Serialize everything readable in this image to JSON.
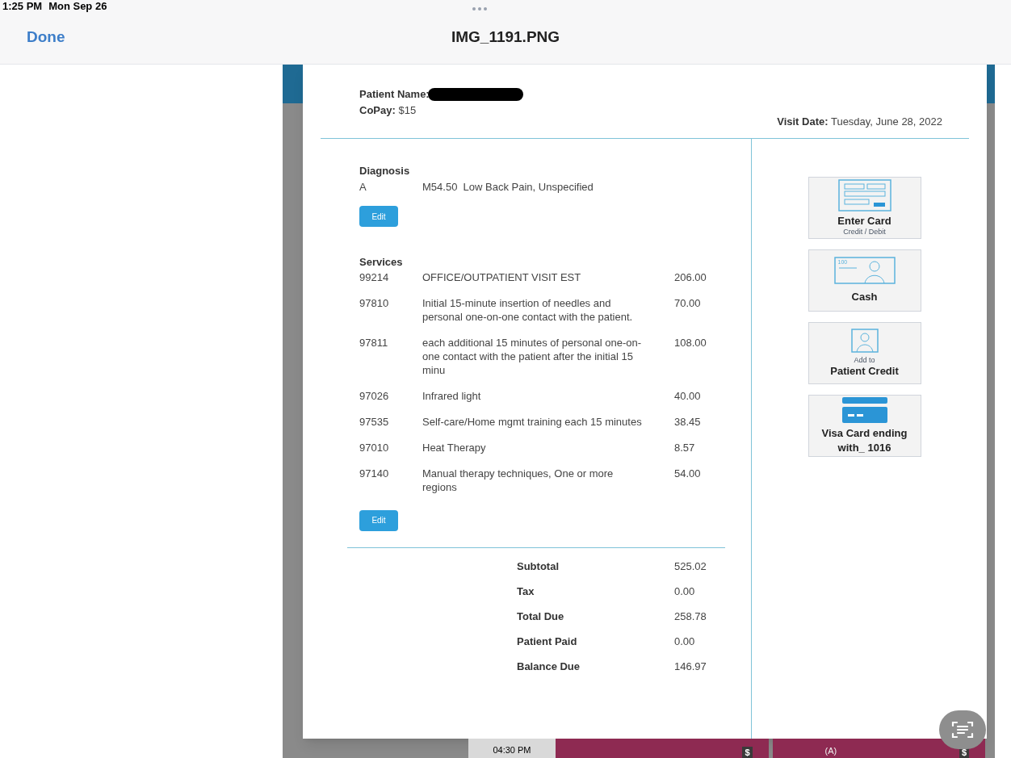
{
  "status_bar": {
    "time": "1:25 PM",
    "date": "Mon Sep 26"
  },
  "viewer": {
    "done": "Done",
    "title": "IMG_1191.PNG"
  },
  "invoice": {
    "patient_label": "Patient Name:",
    "copay_label": "CoPay:",
    "copay": "$15",
    "visit_date_label": "Visit Date:",
    "visit_date": "Tuesday, June 28, 2022",
    "diagnosis": {
      "heading": "Diagnosis",
      "items": [
        {
          "letter": "A",
          "text": "M54.50  Low Back Pain, Unspecified"
        }
      ],
      "edit": "Edit"
    },
    "services": {
      "heading": "Services",
      "items": [
        {
          "code": "99214",
          "description": "OFFICE/OUTPATIENT VISIT EST",
          "amount": "206.00"
        },
        {
          "code": "97810",
          "description": "Initial 15-minute insertion of needles and personal one-on-one contact with the patient.",
          "amount": "70.00"
        },
        {
          "code": "97811",
          "description": "each additional 15 minutes of personal one-on-one contact with the patient after the initial 15 minu",
          "amount": "108.00"
        },
        {
          "code": "97026",
          "description": "Infrared light",
          "amount": "40.00"
        },
        {
          "code": "97535",
          "description": "Self-care/Home mgmt training each 15 minutes",
          "amount": "38.45"
        },
        {
          "code": "97010",
          "description": "Heat Therapy",
          "amount": "8.57"
        },
        {
          "code": "97140",
          "description": "Manual therapy techniques, One or more regions",
          "amount": "54.00"
        }
      ],
      "edit": "Edit"
    },
    "totals": [
      {
        "label": "Subtotal",
        "value": "525.02"
      },
      {
        "label": "Tax",
        "value": "0.00"
      },
      {
        "label": "Total Due",
        "value": "258.78"
      },
      {
        "label": "Patient Paid",
        "value": "0.00"
      },
      {
        "label": "Balance Due",
        "value": "146.97"
      }
    ],
    "payment_options": [
      {
        "kind": "card",
        "title": "Enter Card",
        "subtitle": "Credit / Debit"
      },
      {
        "kind": "cash",
        "title": "Cash",
        "icon_text": "100"
      },
      {
        "kind": "credit",
        "subtitle": "Add to",
        "title": "Patient Credit"
      },
      {
        "kind": "saved",
        "title": "Visa Card ending with_ 1016"
      }
    ]
  },
  "background_row": {
    "time": "04:30 PM",
    "slots": [
      {
        "symbol": "$"
      },
      {
        "tag": "(A)",
        "symbol": "$"
      }
    ]
  }
}
